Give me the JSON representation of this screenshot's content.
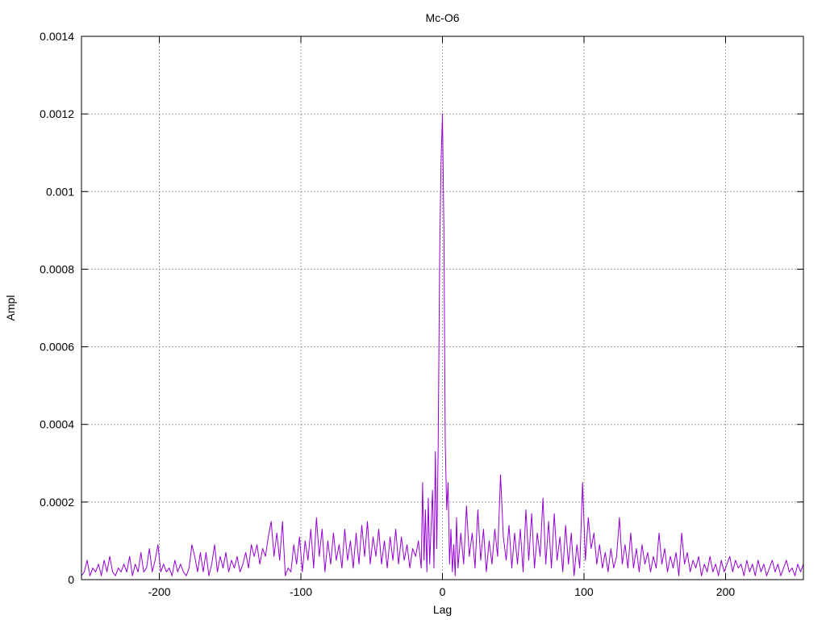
{
  "chart_data": {
    "type": "line",
    "title": "Mc-O6",
    "xlabel": "Lag",
    "ylabel": "Ampl",
    "xlim": [
      -255,
      255
    ],
    "ylim": [
      0,
      0.0014
    ],
    "x_ticks": [
      -200,
      -100,
      0,
      100,
      200
    ],
    "x_tick_labels": [
      "-200",
      "-100",
      "0",
      "100",
      "200"
    ],
    "y_ticks": [
      0,
      0.0002,
      0.0004,
      0.0006,
      0.0008,
      0.001,
      0.0012,
      0.0014
    ],
    "y_tick_labels": [
      "0",
      "0.0002",
      "0.0004",
      "0.0006",
      "0.0008",
      "0.001",
      "0.0012",
      "0.0014"
    ],
    "grid": true,
    "series": [
      {
        "color": "#9400d3",
        "points": [
          [
            -255,
            1e-05
          ],
          [
            -253,
            2e-05
          ],
          [
            -251,
            5e-05
          ],
          [
            -249,
            1e-05
          ],
          [
            -247,
            3e-05
          ],
          [
            -245,
            2e-05
          ],
          [
            -243,
            4e-05
          ],
          [
            -241,
            1e-05
          ],
          [
            -239,
            5e-05
          ],
          [
            -237,
            2e-05
          ],
          [
            -235,
            6e-05
          ],
          [
            -233,
            2e-05
          ],
          [
            -231,
            1e-05
          ],
          [
            -229,
            3e-05
          ],
          [
            -227,
            2e-05
          ],
          [
            -225,
            4e-05
          ],
          [
            -223,
            2e-05
          ],
          [
            -221,
            6e-05
          ],
          [
            -219,
            1e-05
          ],
          [
            -217,
            4e-05
          ],
          [
            -215,
            2e-05
          ],
          [
            -213,
            7e-05
          ],
          [
            -211,
            2e-05
          ],
          [
            -209,
            3e-05
          ],
          [
            -207,
            8e-05
          ],
          [
            -205,
            2e-05
          ],
          [
            -203,
            5e-05
          ],
          [
            -201,
            9e-05
          ],
          [
            -199,
            2e-05
          ],
          [
            -197,
            4e-05
          ],
          [
            -195,
            2e-05
          ],
          [
            -193,
            3e-05
          ],
          [
            -191,
            1e-05
          ],
          [
            -189,
            5e-05
          ],
          [
            -187,
            2e-05
          ],
          [
            -185,
            4e-05
          ],
          [
            -183,
            2e-05
          ],
          [
            -181,
            1e-05
          ],
          [
            -179,
            3e-05
          ],
          [
            -177,
            9e-05
          ],
          [
            -175,
            6e-05
          ],
          [
            -173,
            2e-05
          ],
          [
            -171,
            7e-05
          ],
          [
            -169,
            2e-05
          ],
          [
            -167,
            7e-05
          ],
          [
            -165,
            1e-05
          ],
          [
            -163,
            4e-05
          ],
          [
            -161,
            9e-05
          ],
          [
            -159,
            2e-05
          ],
          [
            -157,
            6e-05
          ],
          [
            -155,
            3e-05
          ],
          [
            -153,
            7e-05
          ],
          [
            -151,
            2e-05
          ],
          [
            -149,
            5e-05
          ],
          [
            -147,
            3e-05
          ],
          [
            -145,
            6e-05
          ],
          [
            -143,
            2e-05
          ],
          [
            -141,
            4e-05
          ],
          [
            -139,
            7e-05
          ],
          [
            -137,
            3e-05
          ],
          [
            -135,
            9e-05
          ],
          [
            -133,
            6e-05
          ],
          [
            -131,
            9e-05
          ],
          [
            -129,
            4e-05
          ],
          [
            -127,
            8e-05
          ],
          [
            -125,
            6e-05
          ],
          [
            -123,
            0.00011
          ],
          [
            -121,
            0.00015
          ],
          [
            -119,
            6e-05
          ],
          [
            -117,
            0.00012
          ],
          [
            -115,
            5e-05
          ],
          [
            -113,
            0.00015
          ],
          [
            -111,
            1e-05
          ],
          [
            -109,
            3e-05
          ],
          [
            -107,
            2e-05
          ],
          [
            -105,
            9e-05
          ],
          [
            -103,
            4e-05
          ],
          [
            -101,
            0.00011
          ],
          [
            -99,
            2e-05
          ],
          [
            -97,
            0.0001
          ],
          [
            -95,
            5e-05
          ],
          [
            -93,
            0.00013
          ],
          [
            -91,
            3e-05
          ],
          [
            -89,
            0.00016
          ],
          [
            -87,
            6e-05
          ],
          [
            -85,
            0.00013
          ],
          [
            -83,
            2e-05
          ],
          [
            -81,
            0.0001
          ],
          [
            -79,
            4e-05
          ],
          [
            -77,
            0.00012
          ],
          [
            -75,
            5e-05
          ],
          [
            -73,
            9e-05
          ],
          [
            -71,
            3e-05
          ],
          [
            -69,
            0.00013
          ],
          [
            -67,
            5e-05
          ],
          [
            -65,
            0.0001
          ],
          [
            -63,
            3e-05
          ],
          [
            -61,
            0.00012
          ],
          [
            -59,
            4e-05
          ],
          [
            -57,
            0.00014
          ],
          [
            -55,
            6e-05
          ],
          [
            -53,
            0.00015
          ],
          [
            -51,
            4e-05
          ],
          [
            -49,
            0.00011
          ],
          [
            -47,
            6e-05
          ],
          [
            -45,
            0.00013
          ],
          [
            -43,
            4e-05
          ],
          [
            -41,
            0.0001
          ],
          [
            -39,
            3e-05
          ],
          [
            -37,
            0.00011
          ],
          [
            -35,
            5e-05
          ],
          [
            -33,
            0.00013
          ],
          [
            -31,
            4e-05
          ],
          [
            -29,
            0.00011
          ],
          [
            -27,
            5e-05
          ],
          [
            -25,
            9e-05
          ],
          [
            -23,
            3e-05
          ],
          [
            -21,
            8e-05
          ],
          [
            -19,
            6e-05
          ],
          [
            -17,
            0.0001
          ],
          [
            -15,
            3e-05
          ],
          [
            -14,
            0.00025
          ],
          [
            -13,
            5e-05
          ],
          [
            -12,
            0.00018
          ],
          [
            -11,
            2e-05
          ],
          [
            -10,
            0.00021
          ],
          [
            -9,
            4e-05
          ],
          [
            -8,
            0.00014
          ],
          [
            -7,
            0.00023
          ],
          [
            -6,
            3e-05
          ],
          [
            -5,
            0.00033
          ],
          [
            -4,
            8e-05
          ],
          [
            -3,
            0.00034
          ],
          [
            -2,
            0.00082
          ],
          [
            -1,
            0.00107
          ],
          [
            0,
            0.0012
          ],
          [
            1,
            0.0009
          ],
          [
            2,
            0.00035
          ],
          [
            3,
            0.00018
          ],
          [
            4,
            0.00025
          ],
          [
            5,
            4e-05
          ],
          [
            6,
            0.00013
          ],
          [
            7,
            2e-05
          ],
          [
            8,
            9e-05
          ],
          [
            9,
            1e-05
          ],
          [
            10,
            0.00016
          ],
          [
            11,
            3e-05
          ],
          [
            13,
            0.00012
          ],
          [
            15,
            4e-05
          ],
          [
            17,
            0.00019
          ],
          [
            19,
            6e-05
          ],
          [
            21,
            0.00012
          ],
          [
            23,
            3e-05
          ],
          [
            25,
            0.00018
          ],
          [
            27,
            5e-05
          ],
          [
            29,
            0.00013
          ],
          [
            31,
            2e-05
          ],
          [
            33,
            0.0001
          ],
          [
            35,
            4e-05
          ],
          [
            37,
            0.00013
          ],
          [
            39,
            6e-05
          ],
          [
            41,
            0.00027
          ],
          [
            43,
            0.00011
          ],
          [
            45,
            5e-05
          ],
          [
            47,
            0.00014
          ],
          [
            49,
            3e-05
          ],
          [
            51,
            0.00012
          ],
          [
            53,
            4e-05
          ],
          [
            55,
            0.00013
          ],
          [
            57,
            2e-05
          ],
          [
            59,
            0.00018
          ],
          [
            61,
            5e-05
          ],
          [
            63,
            0.00017
          ],
          [
            65,
            3e-05
          ],
          [
            67,
            0.00012
          ],
          [
            69,
            6e-05
          ],
          [
            71,
            0.00021
          ],
          [
            73,
            4e-05
          ],
          [
            75,
            0.00015
          ],
          [
            77,
            3e-05
          ],
          [
            79,
            0.00017
          ],
          [
            81,
            5e-05
          ],
          [
            83,
            0.00011
          ],
          [
            85,
            2e-05
          ],
          [
            87,
            0.00014
          ],
          [
            89,
            4e-05
          ],
          [
            91,
            0.00012
          ],
          [
            93,
            1e-05
          ],
          [
            95,
            9e-05
          ],
          [
            97,
            3e-05
          ],
          [
            99,
            0.00025
          ],
          [
            101,
            5e-05
          ],
          [
            103,
            0.00016
          ],
          [
            105,
            8e-05
          ],
          [
            107,
            0.00012
          ],
          [
            109,
            4e-05
          ],
          [
            111,
            9e-05
          ],
          [
            113,
            3e-05
          ],
          [
            115,
            7e-05
          ],
          [
            117,
            2e-05
          ],
          [
            119,
            8e-05
          ],
          [
            121,
            3e-05
          ],
          [
            123,
            6e-05
          ],
          [
            125,
            0.00016
          ],
          [
            127,
            4e-05
          ],
          [
            129,
            9e-05
          ],
          [
            131,
            3e-05
          ],
          [
            133,
            0.00012
          ],
          [
            135,
            3e-05
          ],
          [
            137,
            8e-05
          ],
          [
            139,
            2e-05
          ],
          [
            141,
            9e-05
          ],
          [
            143,
            4e-05
          ],
          [
            145,
            7e-05
          ],
          [
            147,
            2e-05
          ],
          [
            149,
            6e-05
          ],
          [
            151,
            3e-05
          ],
          [
            153,
            0.00012
          ],
          [
            155,
            4e-05
          ],
          [
            157,
            8e-05
          ],
          [
            159,
            2e-05
          ],
          [
            161,
            6e-05
          ],
          [
            163,
            3e-05
          ],
          [
            165,
            7e-05
          ],
          [
            167,
            1e-05
          ],
          [
            169,
            0.00012
          ],
          [
            171,
            4e-05
          ],
          [
            173,
            7e-05
          ],
          [
            175,
            2e-05
          ],
          [
            177,
            5e-05
          ],
          [
            179,
            3e-05
          ],
          [
            181,
            6e-05
          ],
          [
            183,
            1e-05
          ],
          [
            185,
            4e-05
          ],
          [
            187,
            2e-05
          ],
          [
            189,
            6e-05
          ],
          [
            191,
            2e-05
          ],
          [
            193,
            4e-05
          ],
          [
            195,
            1e-05
          ],
          [
            197,
            5e-05
          ],
          [
            199,
            2e-05
          ],
          [
            201,
            4e-05
          ],
          [
            203,
            6e-05
          ],
          [
            205,
            2e-05
          ],
          [
            207,
            5e-05
          ],
          [
            209,
            3e-05
          ],
          [
            211,
            4e-05
          ],
          [
            213,
            1e-05
          ],
          [
            215,
            5e-05
          ],
          [
            217,
            2e-05
          ],
          [
            219,
            4e-05
          ],
          [
            221,
            1e-05
          ],
          [
            223,
            5e-05
          ],
          [
            225,
            2e-05
          ],
          [
            227,
            4e-05
          ],
          [
            229,
            1e-05
          ],
          [
            231,
            3e-05
          ],
          [
            233,
            5e-05
          ],
          [
            235,
            2e-05
          ],
          [
            237,
            4e-05
          ],
          [
            239,
            1e-05
          ],
          [
            241,
            3e-05
          ],
          [
            243,
            5e-05
          ],
          [
            245,
            2e-05
          ],
          [
            247,
            3e-05
          ],
          [
            249,
            1e-05
          ],
          [
            251,
            4e-05
          ],
          [
            253,
            2e-05
          ],
          [
            255,
            4e-05
          ]
        ]
      }
    ]
  }
}
